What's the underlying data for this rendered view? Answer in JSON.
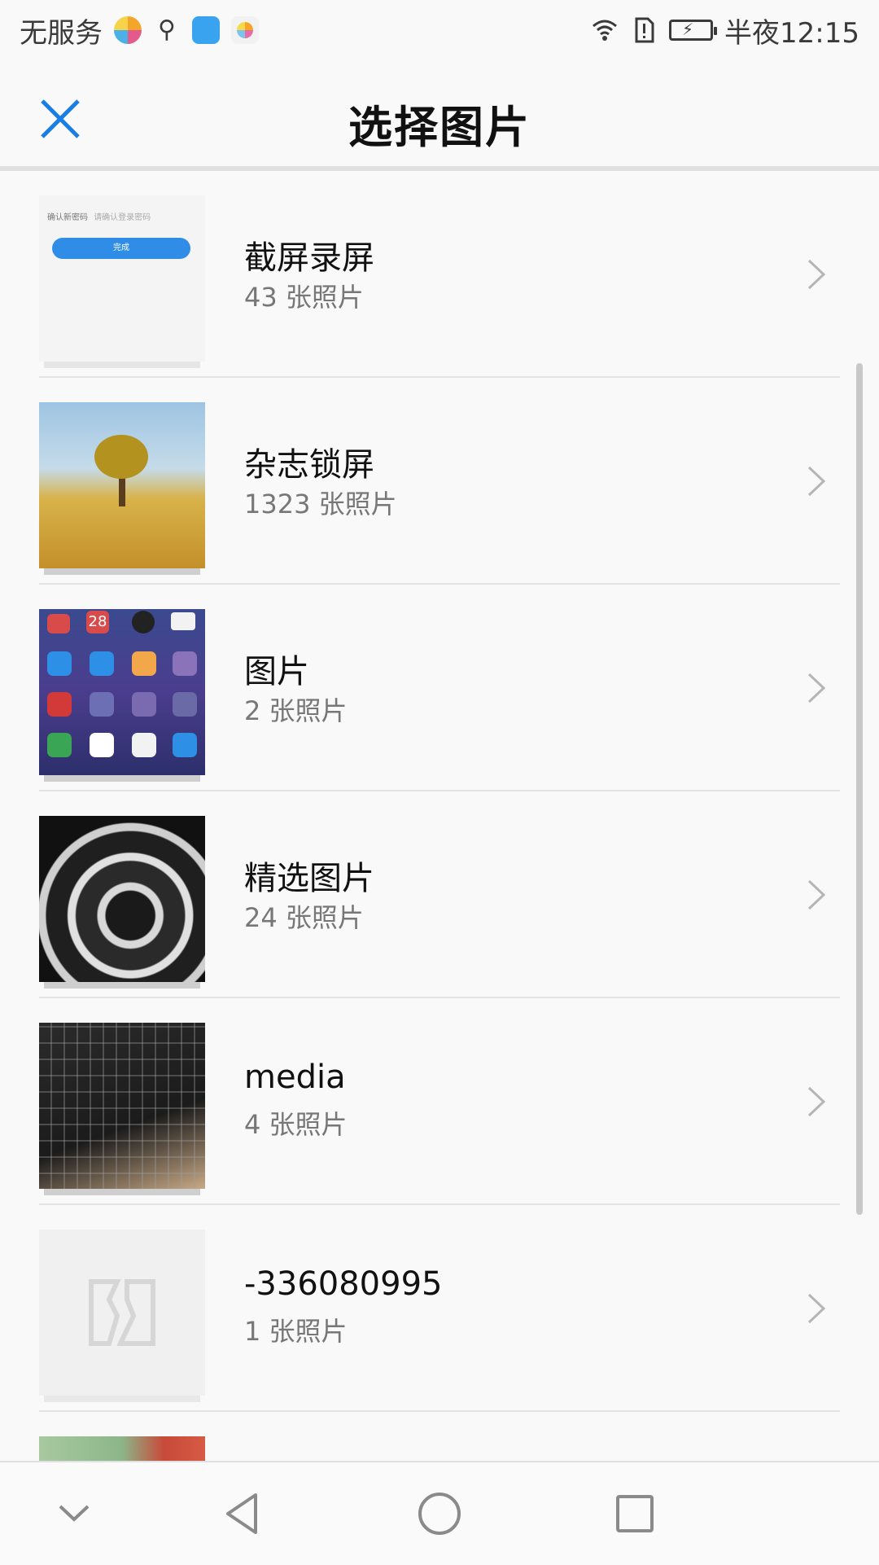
{
  "status_bar": {
    "carrier": "无服务",
    "time": "半夜12:15",
    "icons": [
      "rainbow-app-icon",
      "usb-icon",
      "cloud-app-icon",
      "gallery-app-icon",
      "wifi-icon",
      "alert-sim-icon",
      "battery-charging-icon"
    ]
  },
  "header": {
    "title": "选择图片",
    "close_icon": "close-icon",
    "accent_color": "#1a7ee6"
  },
  "thumbnail_text": {
    "screenshot_label": "确认新密码",
    "screenshot_placeholder": "请确认登录密码",
    "screenshot_button": "完成",
    "apps_date": "28"
  },
  "albums": [
    {
      "name": "截屏录屏",
      "count": "43 张照片"
    },
    {
      "name": "杂志锁屏",
      "count": "1323 张照片"
    },
    {
      "name": "图片",
      "count": "2 张照片"
    },
    {
      "name": "精选图片",
      "count": "24 张照片"
    },
    {
      "name": "media",
      "count": "4 张照片"
    },
    {
      "name": "-336080995",
      "count": "1 张照片"
    }
  ],
  "nav_bar": {
    "icons": [
      "collapse-down-icon",
      "back-icon",
      "home-icon",
      "recents-icon"
    ]
  }
}
